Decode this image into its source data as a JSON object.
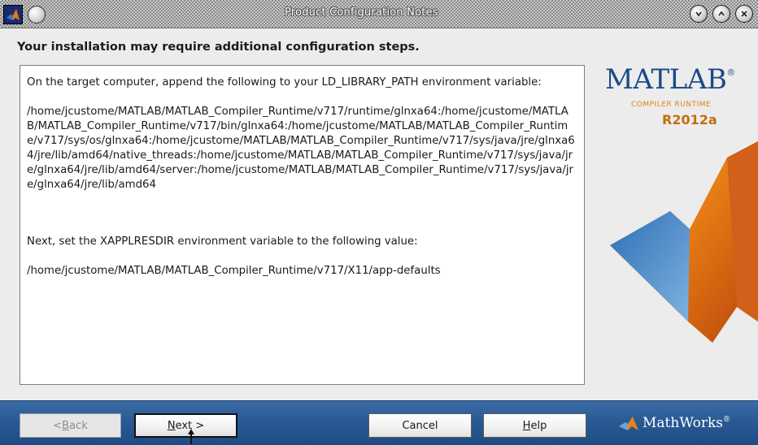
{
  "window": {
    "title": "Product Configuration Notes"
  },
  "header": {
    "text": "Your installation may require additional configuration steps."
  },
  "notes": {
    "intro": "On the target computer, append the following to your LD_LIBRARY_PATH environment variable:",
    "ld_library_path": "/home/jcustome/MATLAB/MATLAB_Compiler_Runtime/v717/runtime/glnxa64:/home/jcustome/MATLAB/MATLAB_Compiler_Runtime/v717/bin/glnxa64:/home/jcustome/MATLAB/MATLAB_Compiler_Runtime/v717/sys/os/glnxa64:/home/jcustome/MATLAB/MATLAB_Compiler_Runtime/v717/sys/java/jre/glnxa64/jre/lib/amd64/native_threads:/home/jcustome/MATLAB/MATLAB_Compiler_Runtime/v717/sys/java/jre/glnxa64/jre/lib/amd64/server:/home/jcustome/MATLAB/MATLAB_Compiler_Runtime/v717/sys/java/jre/glnxa64/jre/lib/amd64",
    "next_instruction": "Next, set the XAPPLRESDIR environment variable to the following value:",
    "xapplresdir": "/home/jcustome/MATLAB/MATLAB_Compiler_Runtime/v717/X11/app-defaults"
  },
  "logo": {
    "product": "MATLAB",
    "registered": "®",
    "subtitle": "COMPILER RUNTIME",
    "release": "R2012a"
  },
  "buttons": {
    "back": {
      "pre": "< ",
      "accel": "B",
      "post": "ack"
    },
    "next": {
      "pre": "",
      "accel": "N",
      "post": "ext >"
    },
    "cancel": {
      "label": "Cancel"
    },
    "help": {
      "pre": "",
      "accel": "H",
      "post": "elp"
    }
  },
  "footer": {
    "brand": "MathWorks",
    "brand_mark": "®"
  },
  "colors": {
    "matlab_blue": "#1d4a86",
    "runtime_orange": "#e0820d",
    "footer_blue": "#2a5a95"
  }
}
